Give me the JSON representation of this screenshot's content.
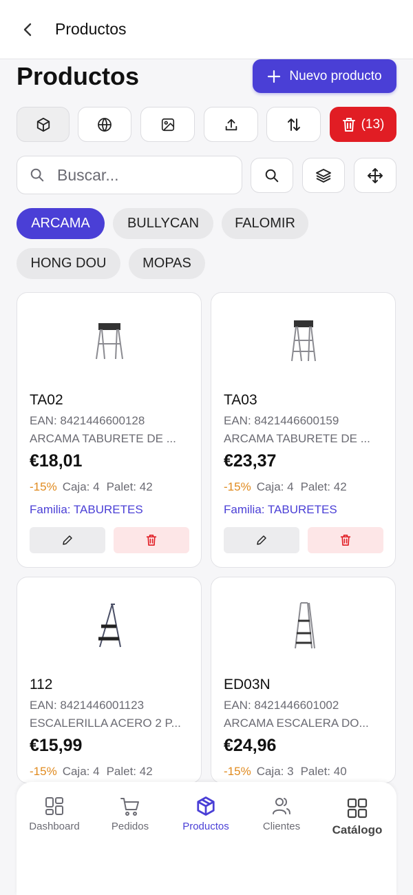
{
  "header": {
    "title": "Productos"
  },
  "page": {
    "title": "Productos",
    "new_button_label": "Nuevo producto"
  },
  "toolbar": {
    "tools": [
      {
        "icon": "cube-icon"
      },
      {
        "icon": "globe-icon"
      },
      {
        "icon": "image-icon"
      },
      {
        "icon": "upload-icon"
      },
      {
        "icon": "sort-icon"
      }
    ],
    "delete_count_label": "(13)"
  },
  "search": {
    "placeholder": "Buscar..."
  },
  "brands": [
    "ARCAMA",
    "BULLYCAN",
    "FALOMIR",
    "HONG DOU",
    "MOPAS"
  ],
  "active_brand": "ARCAMA",
  "products": [
    {
      "code": "TA02",
      "ean": "EAN: 8421446600128",
      "description": "ARCAMA TABURETE DE ...",
      "price": "€18,01",
      "discount": "-15%",
      "caja": "Caja: 4",
      "palet": "Palet: 42",
      "family": "Familia: TABURETES"
    },
    {
      "code": "TA03",
      "ean": "EAN: 8421446600159",
      "description": "ARCAMA TABURETE DE ...",
      "price": "€23,37",
      "discount": "-15%",
      "caja": "Caja: 4",
      "palet": "Palet: 42",
      "family": "Familia: TABURETES"
    },
    {
      "code": "112",
      "ean": "EAN: 8421446001123",
      "description": "ESCALERILLA ACERO 2 P...",
      "price": "€15,99",
      "discount": "-15%",
      "caja": "Caja: 4",
      "palet": "Palet: 42",
      "family": ""
    },
    {
      "code": "ED03N",
      "ean": "EAN: 8421446601002",
      "description": "ARCAMA ESCALERA DO...",
      "price": "€24,96",
      "discount": "-15%",
      "caja": "Caja: 3",
      "palet": "Palet: 40",
      "family": ""
    }
  ],
  "nav": {
    "items": [
      {
        "label": "Dashboard",
        "icon": "dashboard-icon"
      },
      {
        "label": "Pedidos",
        "icon": "cart-icon"
      },
      {
        "label": "Productos",
        "icon": "cube-icon"
      },
      {
        "label": "Clientes",
        "icon": "users-icon"
      },
      {
        "label": "Catálogo",
        "icon": "grid-icon"
      }
    ],
    "active": "Productos"
  },
  "colors": {
    "accent": "#4a3fd6",
    "danger": "#e11d24",
    "discount": "#e08a1e",
    "delete_bg": "#fde6e7"
  }
}
